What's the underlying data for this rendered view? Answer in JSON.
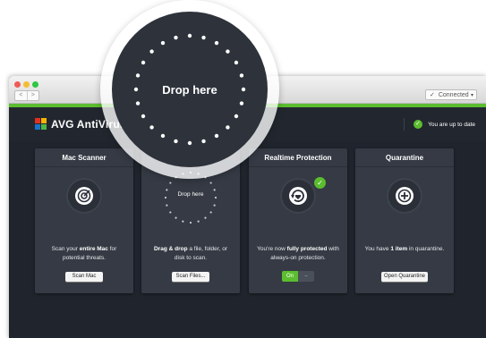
{
  "window": {
    "nav_back": "<",
    "nav_forward": ">",
    "connection_status": "Connected"
  },
  "header": {
    "brand": "AVG AntiVirus",
    "status_text": "You are up to date"
  },
  "colors": {
    "accent_green": "#5bbd2f",
    "app_background": "#20252d",
    "card_background": "#353a44"
  },
  "drop_overlay": {
    "label": "Drop here"
  },
  "cards": [
    {
      "title": "Mac Scanner",
      "icon": "scanner-icon",
      "desc_pre": "Scan your ",
      "desc_bold": "entire Mac",
      "desc_post": " for potential threats.",
      "button": "Scan Mac"
    },
    {
      "title": "",
      "icon": "drop-target-icon",
      "drop_label": "Drop here",
      "desc_bold": "Drag & drop",
      "desc_post": " a file, folder, or disk to scan.",
      "button": "Scan Files..."
    },
    {
      "title": "Realtime Protection",
      "icon": "realtime-protection-icon",
      "desc_pre": "You're now ",
      "desc_bold": "fully protected",
      "desc_post": " with always-on protection.",
      "toggle_on": "On",
      "toggle_off": "–"
    },
    {
      "title": "Quarantine",
      "icon": "quarantine-icon",
      "desc_pre": "You have ",
      "desc_bold": "1 item",
      "desc_post": " in quarantine.",
      "button": "Open Quarantine"
    }
  ]
}
